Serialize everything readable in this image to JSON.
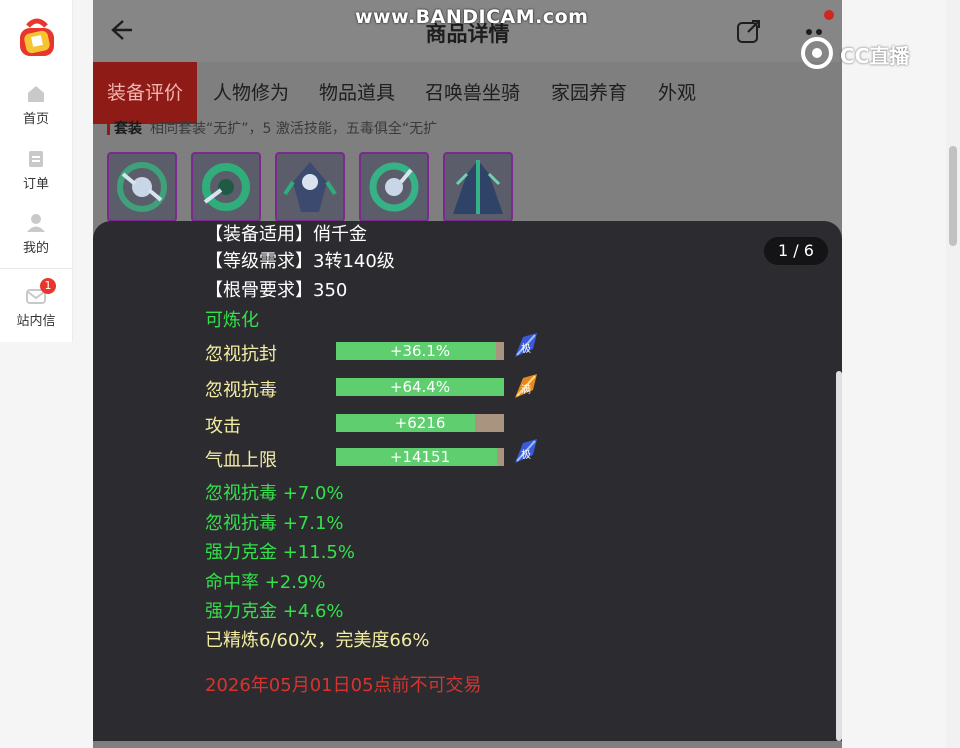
{
  "watermarks": {
    "recorder": "www.BANDICAM.com",
    "brand": "CC直播"
  },
  "sidebar": {
    "items": [
      {
        "label": "首页",
        "icon": "home-icon"
      },
      {
        "label": "订单",
        "icon": "order-icon"
      },
      {
        "label": "我的",
        "icon": "user-icon"
      },
      {
        "label": "站内信",
        "icon": "mail-icon",
        "badge": "1"
      }
    ]
  },
  "header": {
    "title": "商品详情"
  },
  "tabs": [
    "装备评价",
    "人物修为",
    "物品道具",
    "召唤兽坐骑",
    "家园养育",
    "外观"
  ],
  "set_row": {
    "label": "套装",
    "text": "相同套装“无扩”，5 激活技能，五毒俱全“无扩"
  },
  "detail": {
    "counter": "1 / 6",
    "lines": {
      "suit_for": "【装备适用】俏千金",
      "level_req": "【等级需求】3转140级",
      "bone_req": "【根骨要求】350",
      "refinable": "可炼化"
    },
    "stats": [
      {
        "name": "忽视抗封",
        "value": "+36.1%",
        "fill": 0.95,
        "gem": "极"
      },
      {
        "name": "忽视抗毒",
        "value": "+64.4%",
        "fill": 1.0,
        "gem": "满"
      },
      {
        "name": "攻击",
        "value": "+6216",
        "fill": 0.83,
        "gem": ""
      },
      {
        "name": "气血上限",
        "value": "+14151",
        "fill": 0.96,
        "gem": "极"
      }
    ],
    "extras": [
      "忽视抗毒 +7.0%",
      "忽视抗毒 +7.1%",
      "强力克金 +11.5%",
      "命中率 +2.9%",
      "强力克金 +4.6%"
    ],
    "refine": "已精炼6/60次，完美度66%",
    "trade_lock": "2026年05月01日05点前不可交易"
  },
  "colors": {
    "accent_red": "#8e1b16",
    "stat_green": "#33e04a",
    "stat_yellow": "#f2eca0",
    "warn_red": "#d8332e",
    "card_bg": "#2c2c30"
  }
}
